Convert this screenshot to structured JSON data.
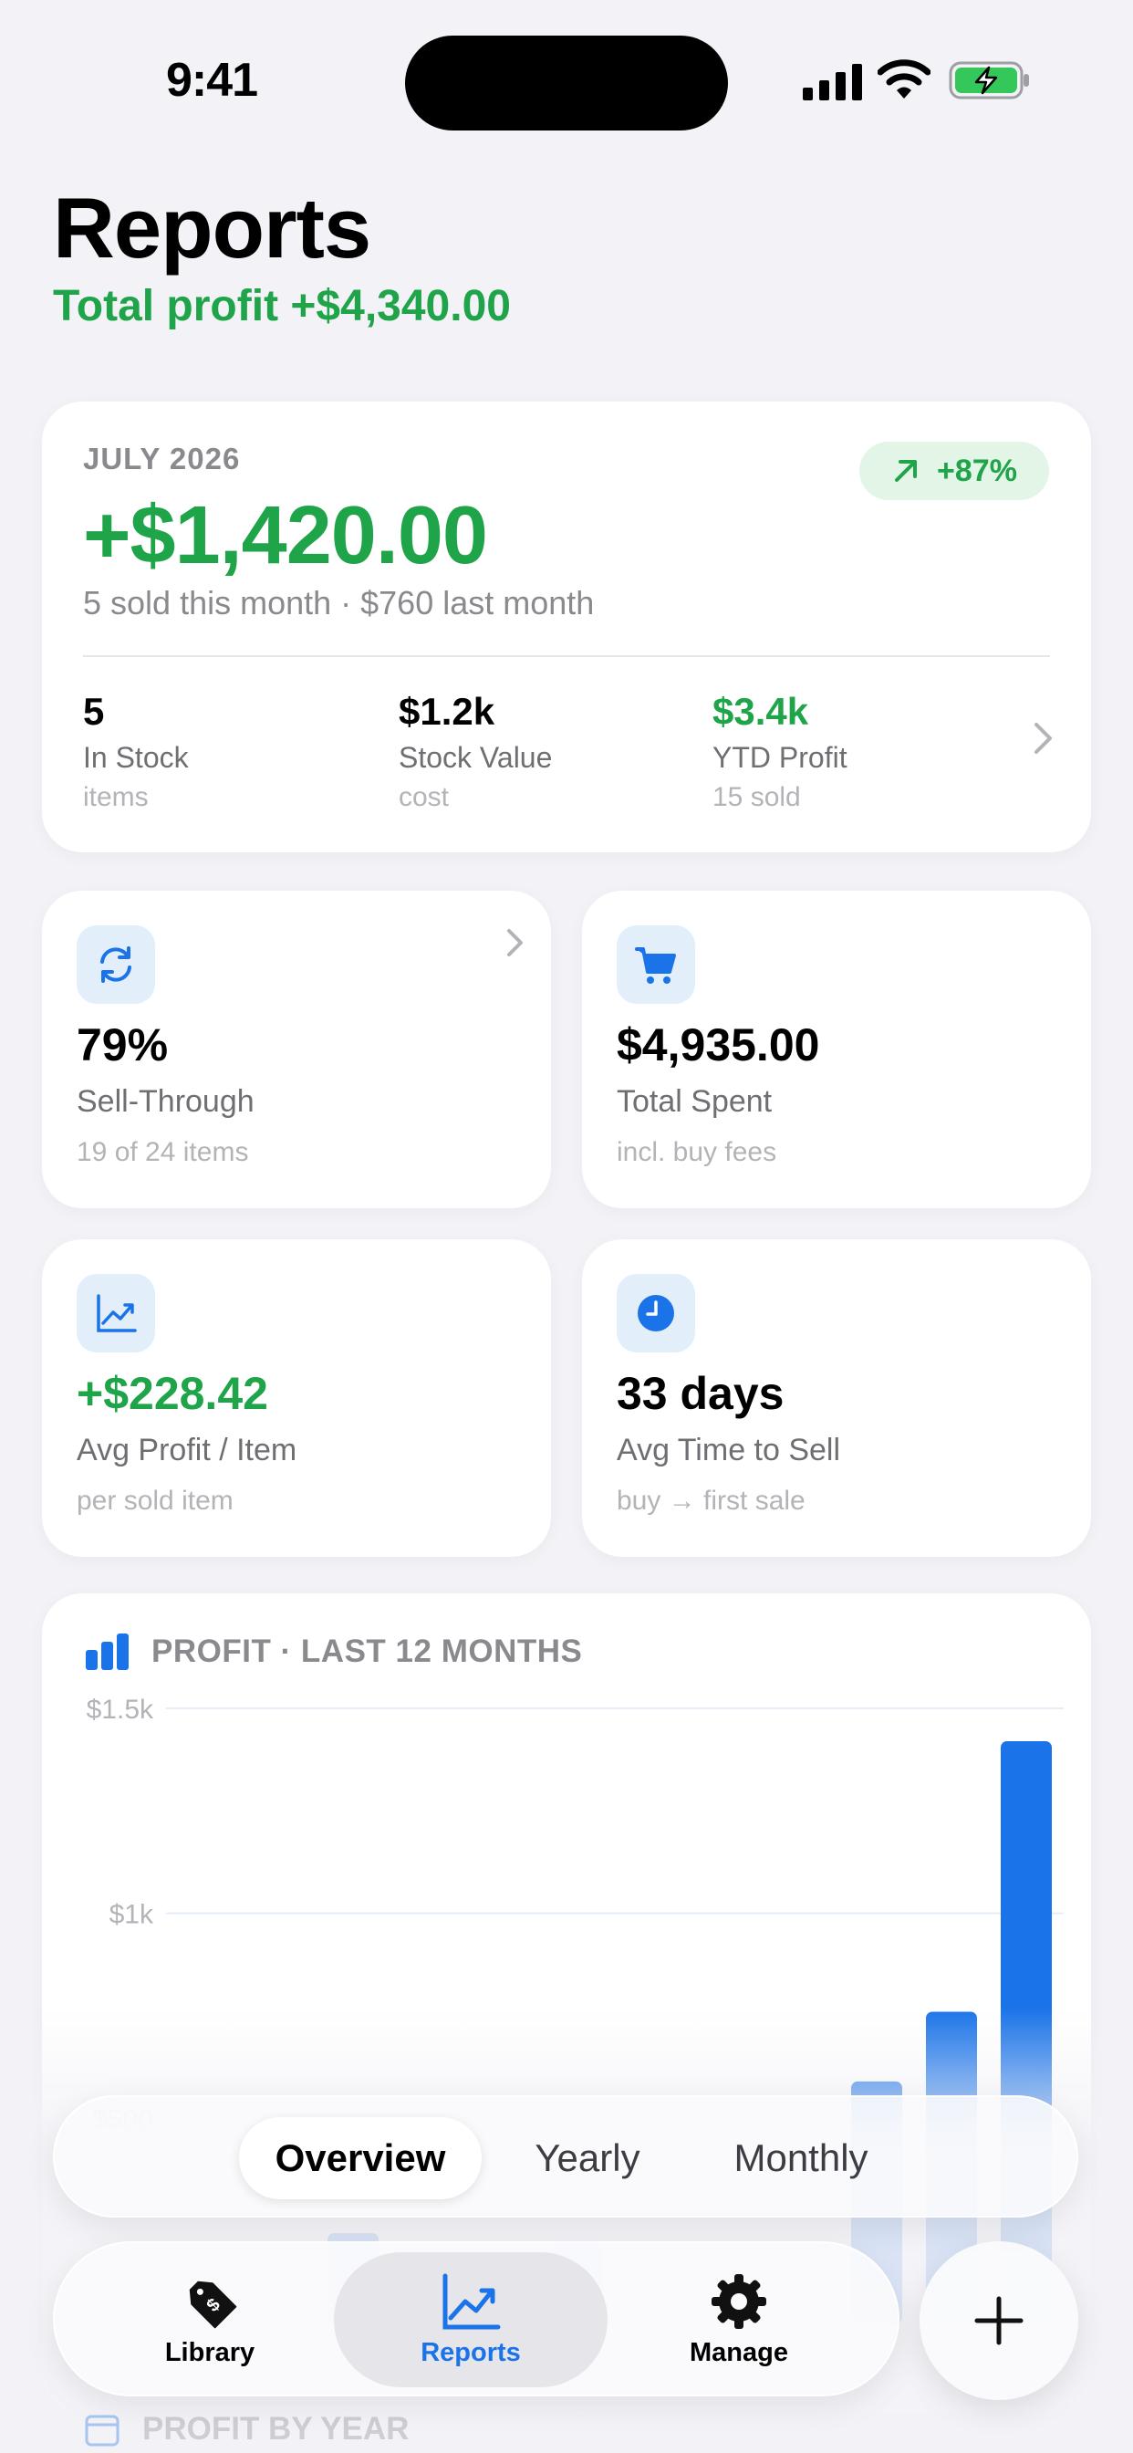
{
  "status_bar": {
    "time": "9:41"
  },
  "header": {
    "title": "Reports",
    "subtitle": "Total profit +$4,340.00"
  },
  "hero": {
    "month": "JULY 2026",
    "badge": "+87%",
    "amount": "+$1,420.00",
    "detail": "5 sold this month · $760 last month",
    "stats": [
      {
        "value": "5",
        "label": "In Stock",
        "sub": "items"
      },
      {
        "value": "$1.2k",
        "label": "Stock Value",
        "sub": "cost"
      },
      {
        "value": "$3.4k",
        "label": "YTD Profit",
        "sub": "15 sold"
      }
    ]
  },
  "metrics": [
    {
      "value": "79%",
      "label": "Sell-Through",
      "sub": "19 of 24 items",
      "icon": "refresh-icon"
    },
    {
      "value": "$4,935.00",
      "label": "Total Spent",
      "sub": "incl. buy fees",
      "icon": "cart-icon"
    },
    {
      "value": "+$228.42",
      "label": "Avg Profit / Item",
      "sub": "per sold item",
      "icon": "trend-chart-icon"
    },
    {
      "value": "33 days",
      "label": "Avg Time to Sell",
      "sub": "buy → first sale",
      "icon": "clock-icon"
    }
  ],
  "chart_data": {
    "type": "bar",
    "title": "PROFIT · LAST 12 MONTHS",
    "ylim": [
      0,
      1500
    ],
    "yticks": [
      {
        "label": "$1.5k",
        "value": 1500
      },
      {
        "label": "$1k",
        "value": 1000
      },
      {
        "label": "$500",
        "value": 500
      }
    ],
    "values": [
      0,
      0,
      220,
      0,
      0,
      200,
      0,
      0,
      0,
      590,
      760,
      1420
    ],
    "grid": true
  },
  "segmented": {
    "options": [
      "Overview",
      "Yearly",
      "Monthly"
    ],
    "selected": "Overview"
  },
  "tabbar": {
    "items": [
      "Library",
      "Reports",
      "Manage"
    ],
    "active": "Reports"
  },
  "next_section": {
    "title": "PROFIT BY YEAR"
  },
  "colors": {
    "green": "#1FA449",
    "blue": "#1A73E8",
    "background": "#F2F2F7"
  }
}
